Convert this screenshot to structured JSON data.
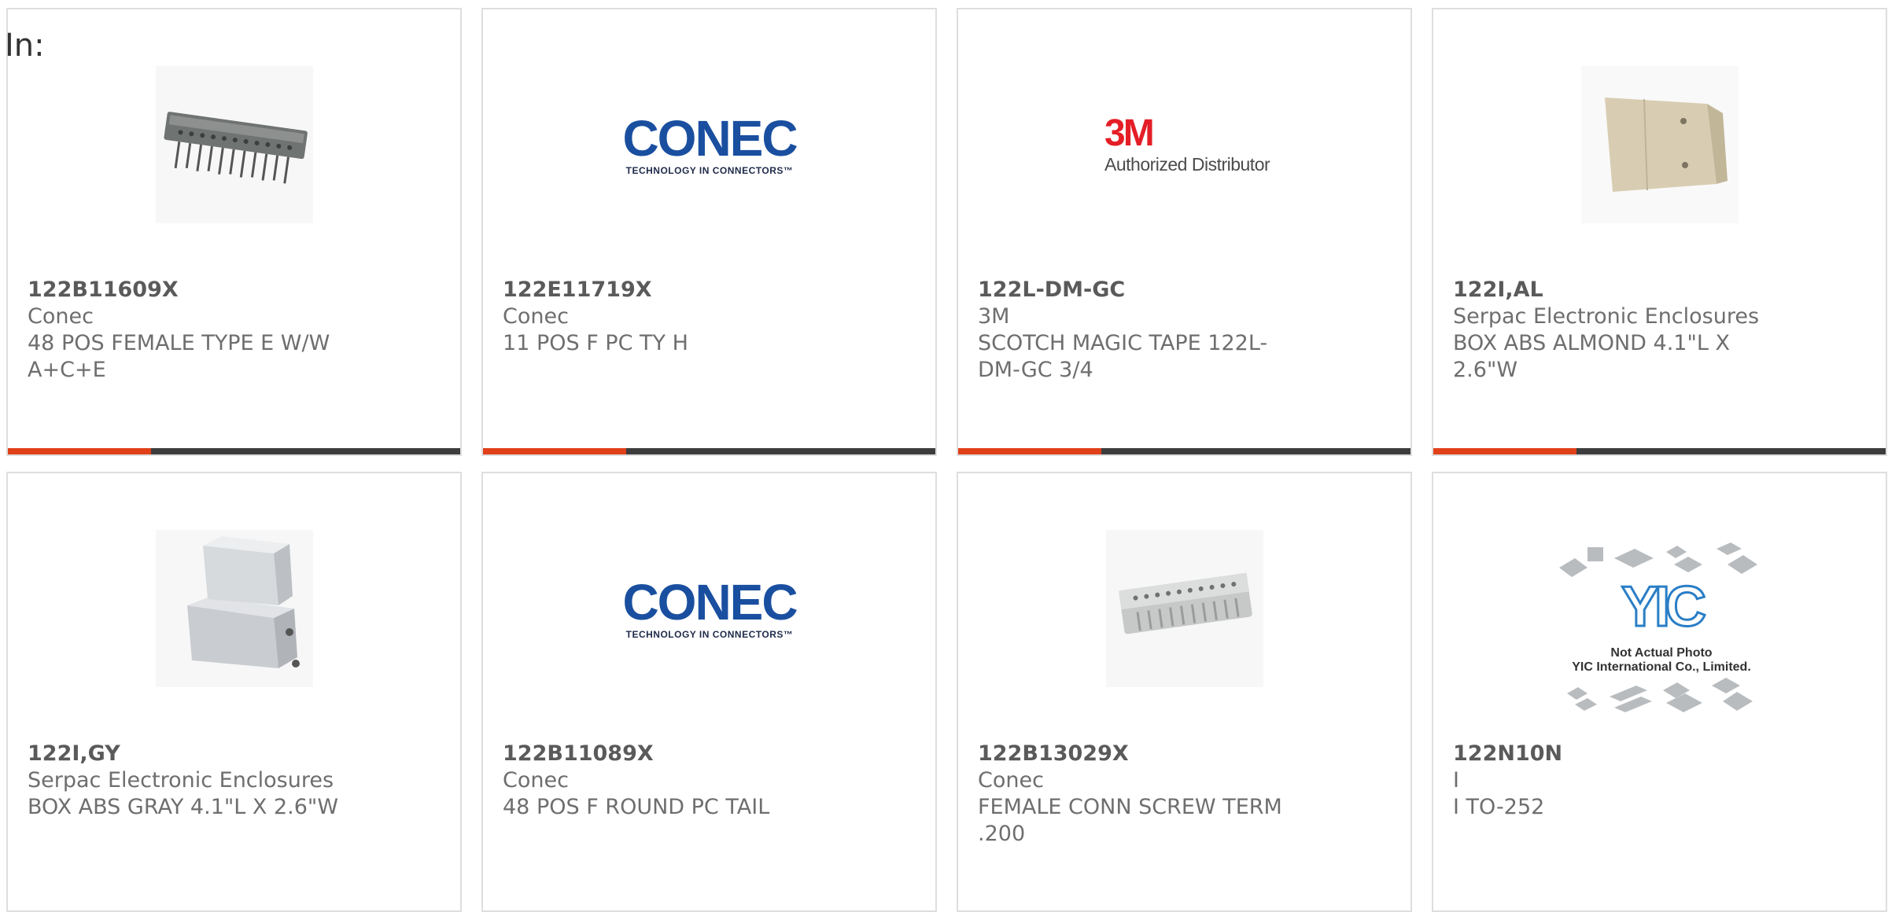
{
  "page": {
    "heading": "In:"
  },
  "colors": {
    "accent": "#e0401a",
    "bar": "#3d3d3d",
    "conec_blue": "#1a4fa0",
    "threem_red": "#e41e26"
  },
  "products": [
    {
      "part_number": "122B11609X",
      "manufacturer": "Conec",
      "description": "48 POS FEMALE TYPE E W/W A+C+E",
      "image": "connector-photo"
    },
    {
      "part_number": "122E11719X",
      "manufacturer": "Conec",
      "description": "11 POS F PC TY H",
      "image": "conec-logo"
    },
    {
      "part_number": "122L-DM-GC",
      "manufacturer": "3M",
      "description": "SCOTCH MAGIC TAPE 122L-DM-GC 3/4",
      "image": "3m-logo"
    },
    {
      "part_number": "122I,AL",
      "manufacturer": "Serpac Electronic Enclosures",
      "description": "BOX ABS ALMOND 4.1\"L X 2.6\"W",
      "image": "enclosure-almond"
    },
    {
      "part_number": "122I,GY",
      "manufacturer": "Serpac Electronic Enclosures",
      "description": "BOX ABS GRAY 4.1\"L X 2.6\"W",
      "image": "enclosure-gray"
    },
    {
      "part_number": "122B11089X",
      "manufacturer": "Conec",
      "description": "48 POS F ROUND PC TAIL",
      "image": "conec-logo"
    },
    {
      "part_number": "122B13029X",
      "manufacturer": "Conec",
      "description": "FEMALE CONN SCREW TERM .200",
      "image": "connector-photo-gray"
    },
    {
      "part_number": "122N10N",
      "manufacturer": "I",
      "description": "I TO-252",
      "image": "yic-placeholder"
    }
  ],
  "logos": {
    "conec_text": "CONEC",
    "conec_tagline": "TECHNOLOGY IN CONNECTORS™",
    "threem_text": "3M",
    "threem_tagline": "Authorized Distributor",
    "yic_text": "YIC",
    "yic_caption_1": "Not Actual Photo",
    "yic_caption_2": "YIC International Co., Limited."
  }
}
